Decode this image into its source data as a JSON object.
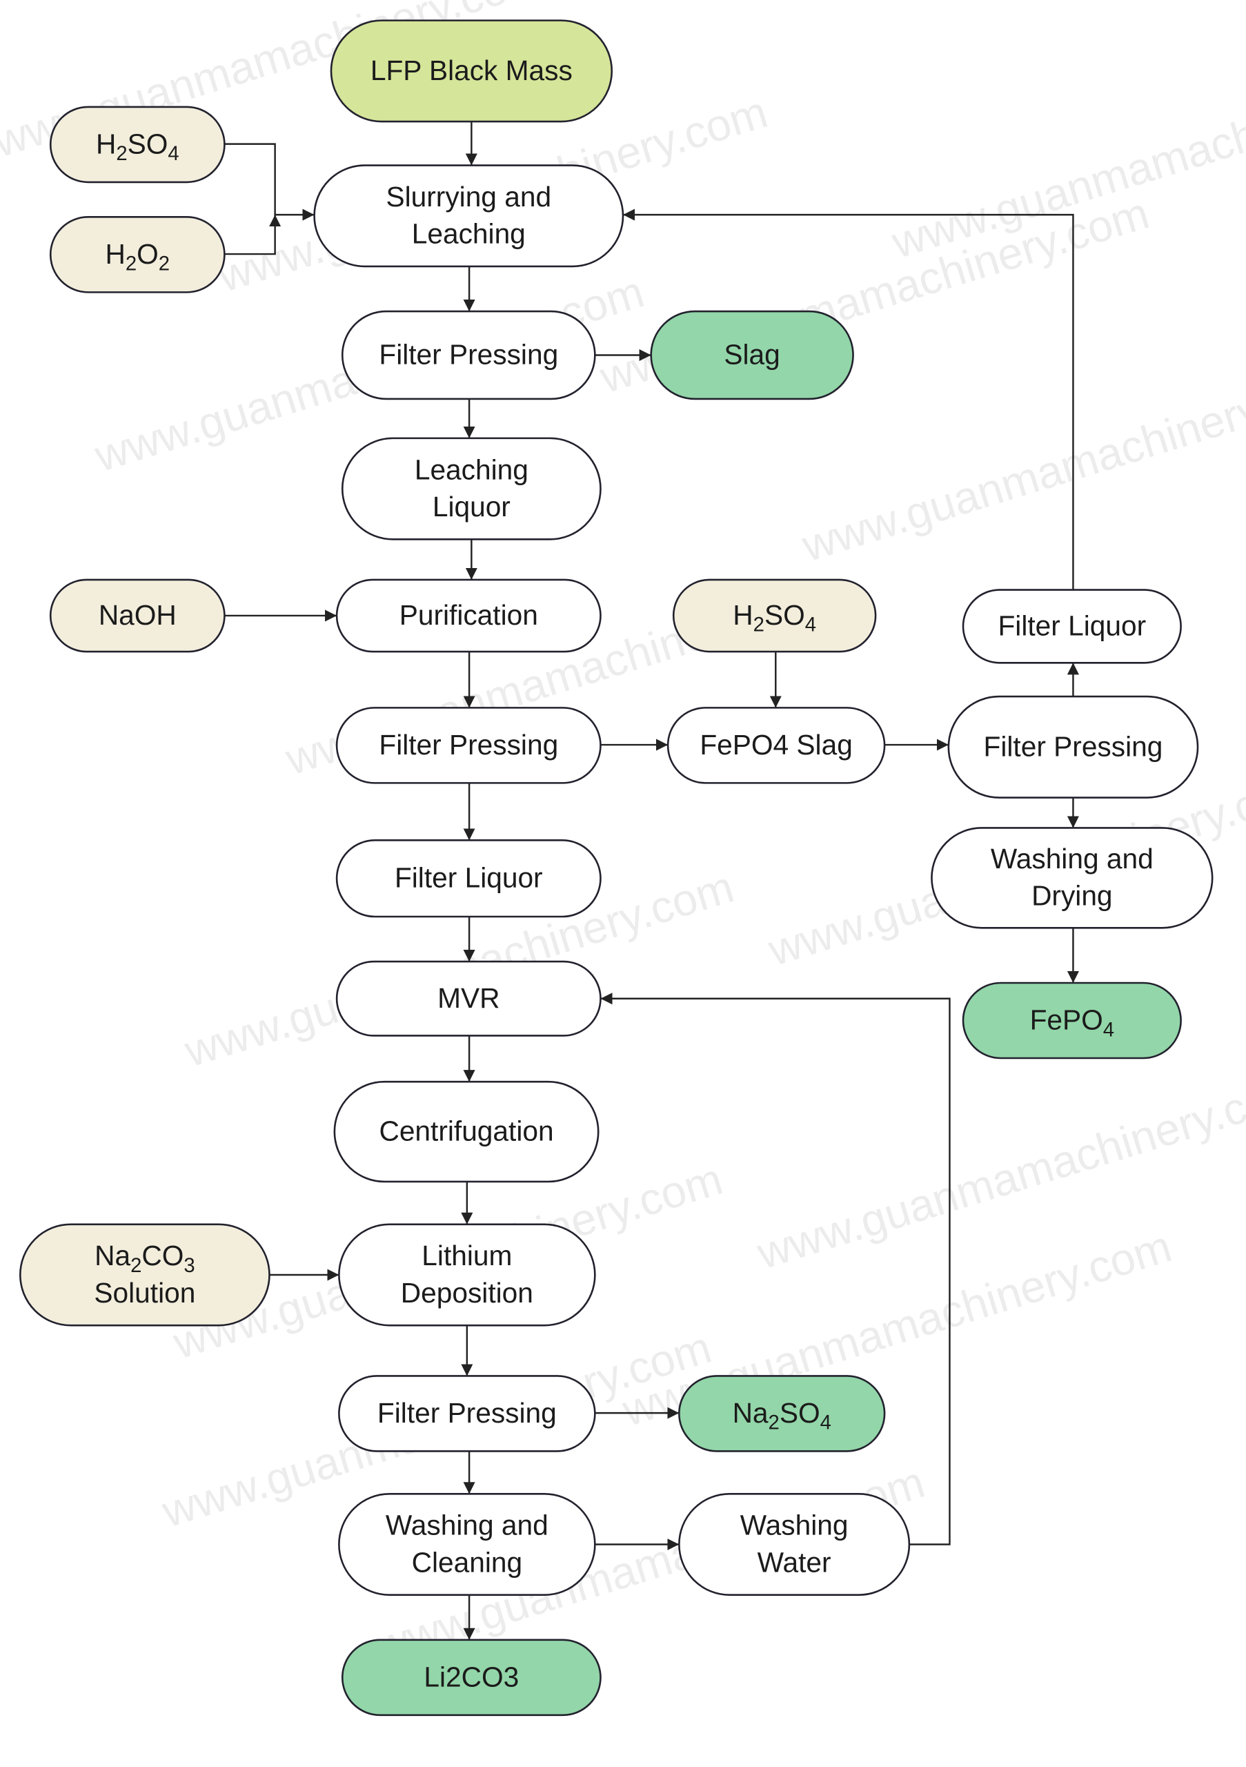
{
  "colors": {
    "source": "#d5e59a",
    "reagent": "#f3eedc",
    "product": "#93d6a9",
    "process": "#ffffff",
    "stroke": "#22222e"
  },
  "watermark": "www.guanmamachinery.com",
  "nodes": [
    {
      "id": "lfp",
      "kind": "source",
      "lines": [
        [
          "LFP Black Mass"
        ]
      ]
    },
    {
      "id": "h2so4a",
      "kind": "reagent",
      "lines": [
        [
          "H",
          {
            "sub": "2"
          },
          "SO",
          {
            "sub": "4"
          }
        ]
      ]
    },
    {
      "id": "h2o2",
      "kind": "reagent",
      "lines": [
        [
          "H",
          {
            "sub": "2"
          },
          "O",
          {
            "sub": "2"
          }
        ]
      ]
    },
    {
      "id": "slurry",
      "kind": "process",
      "lines": [
        [
          "Slurrying and"
        ],
        [
          "Leaching"
        ]
      ]
    },
    {
      "id": "fp1",
      "kind": "process",
      "lines": [
        [
          "Filter Pressing"
        ]
      ]
    },
    {
      "id": "slag",
      "kind": "product",
      "lines": [
        [
          "Slag"
        ]
      ]
    },
    {
      "id": "leachliq",
      "kind": "process",
      "lines": [
        [
          "Leaching"
        ],
        [
          "Liquor"
        ]
      ]
    },
    {
      "id": "naoh",
      "kind": "reagent",
      "lines": [
        [
          "NaOH"
        ]
      ]
    },
    {
      "id": "purif",
      "kind": "process",
      "lines": [
        [
          "Purification"
        ]
      ]
    },
    {
      "id": "h2so4b",
      "kind": "reagent",
      "lines": [
        [
          "H",
          {
            "sub": "2"
          },
          "SO",
          {
            "sub": "4"
          }
        ]
      ]
    },
    {
      "id": "flr",
      "kind": "process",
      "lines": [
        [
          "Filter Liquor"
        ]
      ]
    },
    {
      "id": "fp2",
      "kind": "process",
      "lines": [
        [
          "Filter Pressing"
        ]
      ]
    },
    {
      "id": "fepo4slag",
      "kind": "process",
      "lines": [
        [
          "FePO4 Slag"
        ]
      ]
    },
    {
      "id": "fpr",
      "kind": "process",
      "lines": [
        [
          "Filter Pressing"
        ]
      ]
    },
    {
      "id": "washdry",
      "kind": "process",
      "lines": [
        [
          "Washing and"
        ],
        [
          "Drying"
        ]
      ]
    },
    {
      "id": "fl",
      "kind": "process",
      "lines": [
        [
          "Filter Liquor"
        ]
      ]
    },
    {
      "id": "fepo4",
      "kind": "product",
      "lines": [
        [
          "FePO",
          {
            "sub": "4"
          }
        ]
      ]
    },
    {
      "id": "mvr",
      "kind": "process",
      "lines": [
        [
          "MVR"
        ]
      ]
    },
    {
      "id": "centri",
      "kind": "process",
      "lines": [
        [
          "Centrifugation"
        ]
      ]
    },
    {
      "id": "na2co3",
      "kind": "reagent",
      "lines": [
        [
          "Na",
          {
            "sub": "2"
          },
          "CO",
          {
            "sub": "3"
          }
        ],
        [
          "Solution"
        ]
      ]
    },
    {
      "id": "lidep",
      "kind": "process",
      "lines": [
        [
          "Lithium"
        ],
        [
          "Deposition"
        ]
      ]
    },
    {
      "id": "fp3",
      "kind": "process",
      "lines": [
        [
          "Filter Pressing"
        ]
      ]
    },
    {
      "id": "na2so4",
      "kind": "product",
      "lines": [
        [
          "Na",
          {
            "sub": "2"
          },
          "SO",
          {
            "sub": "4"
          }
        ]
      ]
    },
    {
      "id": "washclean",
      "kind": "process",
      "lines": [
        [
          "Washing and"
        ],
        [
          "Cleaning"
        ]
      ]
    },
    {
      "id": "washwater",
      "kind": "process",
      "lines": [
        [
          "Washing"
        ],
        [
          "Water"
        ]
      ]
    },
    {
      "id": "li2co3",
      "kind": "product",
      "lines": [
        [
          "Li2CO3"
        ]
      ]
    }
  ],
  "edges": [
    [
      "lfp",
      "slurry"
    ],
    [
      "h2so4a",
      "slurry"
    ],
    [
      "h2o2",
      "slurry"
    ],
    [
      "slurry",
      "fp1"
    ],
    [
      "fp1",
      "slag"
    ],
    [
      "fp1",
      "leachliq"
    ],
    [
      "leachliq",
      "purif"
    ],
    [
      "naoh",
      "purif"
    ],
    [
      "purif",
      "fp2"
    ],
    [
      "h2so4b",
      "fepo4slag"
    ],
    [
      "fp2",
      "fepo4slag"
    ],
    [
      "fepo4slag",
      "fpr"
    ],
    [
      "fpr",
      "flr"
    ],
    [
      "flr",
      "slurry"
    ],
    [
      "fpr",
      "washdry"
    ],
    [
      "washdry",
      "fepo4"
    ],
    [
      "fp2",
      "fl"
    ],
    [
      "fl",
      "mvr"
    ],
    [
      "mvr",
      "centri"
    ],
    [
      "centri",
      "lidep"
    ],
    [
      "na2co3",
      "lidep"
    ],
    [
      "lidep",
      "fp3"
    ],
    [
      "fp3",
      "na2so4"
    ],
    [
      "fp3",
      "washclean"
    ],
    [
      "washclean",
      "washwater"
    ],
    [
      "washwater",
      "mvr"
    ],
    [
      "washclean",
      "li2co3"
    ]
  ]
}
